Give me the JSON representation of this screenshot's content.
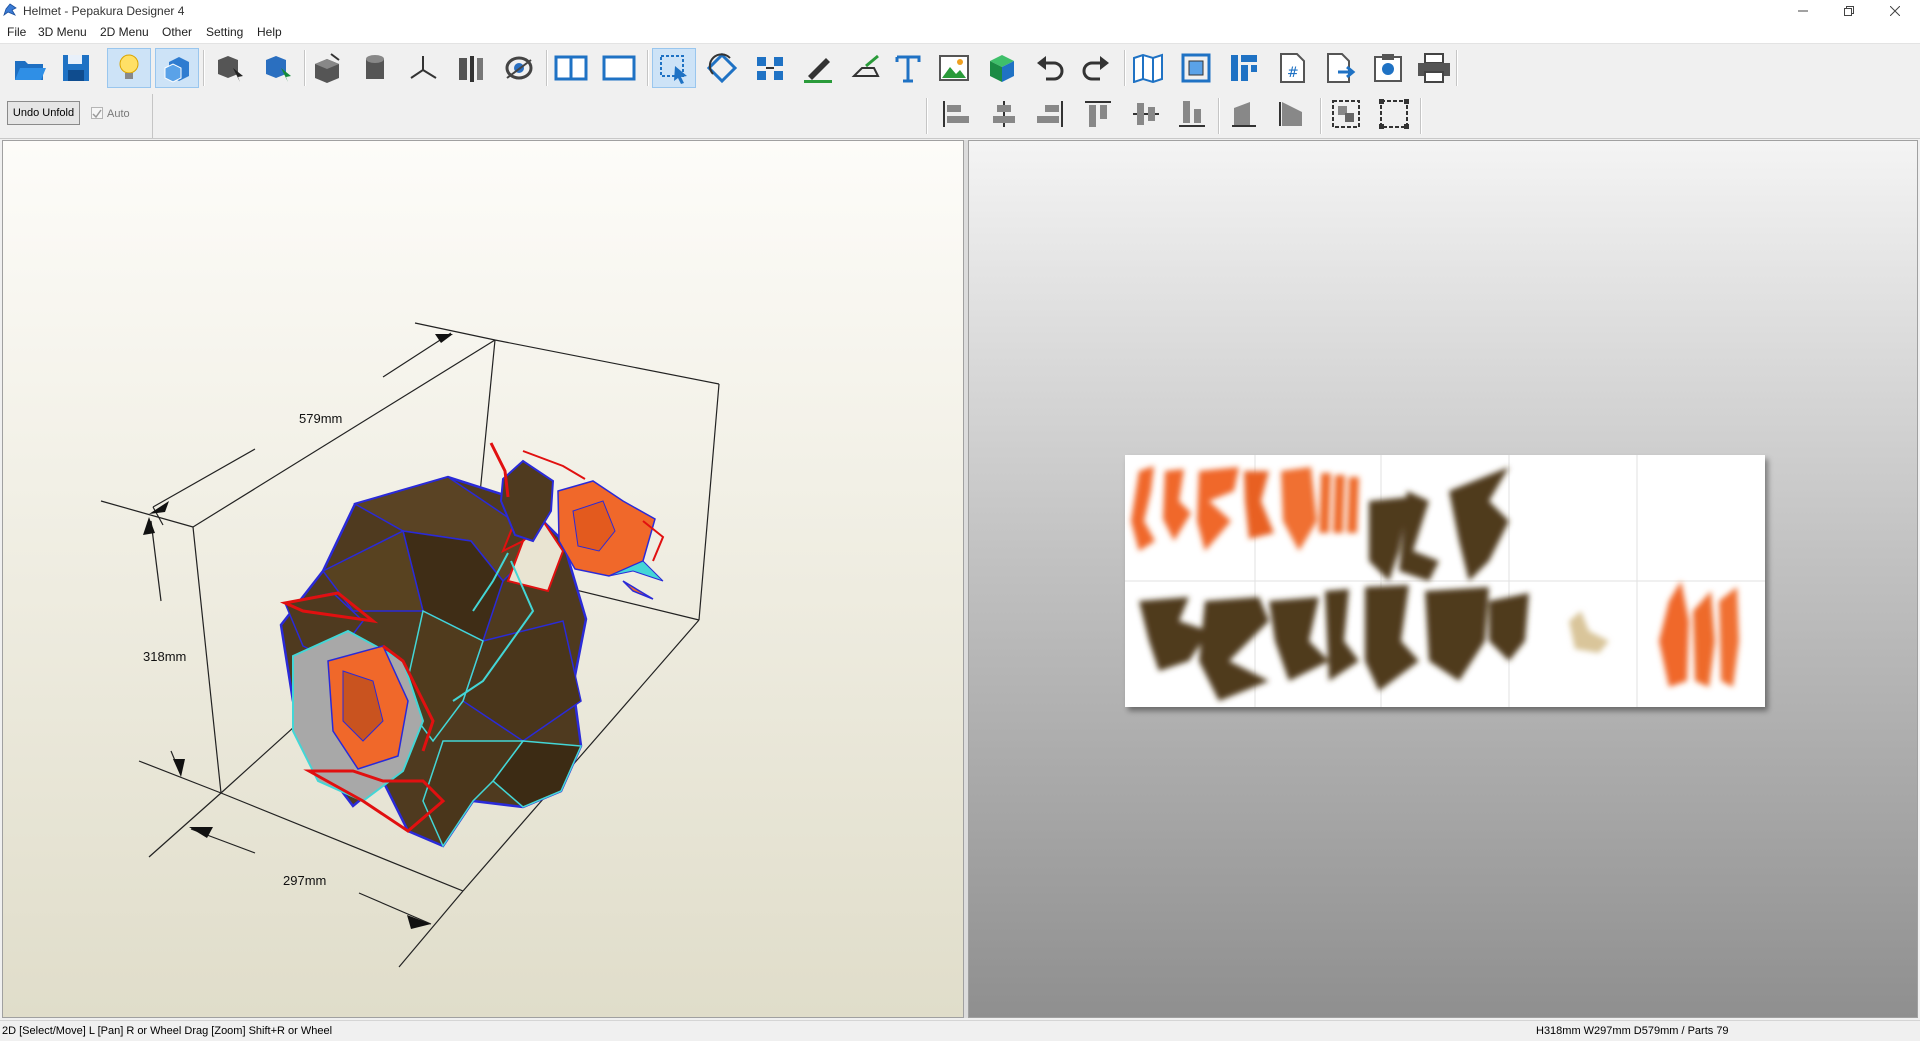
{
  "window": {
    "title": "Helmet - Pepakura Designer 4",
    "controls": [
      "minimize",
      "restore",
      "close"
    ]
  },
  "menu": [
    "File",
    "3D Menu",
    "2D Menu",
    "Other",
    "Setting",
    "Help"
  ],
  "toolbar": {
    "main_icons": [
      "open-icon",
      "save-icon",
      "light-bulb-icon",
      "texture-icon",
      "select-3d-icon",
      "select-face-icon",
      "box-icon",
      "cylinder-icon",
      "axis-icon",
      "columns-icon",
      "eye-icon",
      "split-view-icon",
      "single-view-icon",
      "select-move-icon",
      "rotate-icon",
      "arrange-icon",
      "edit-line-icon",
      "flap-icon",
      "text-icon",
      "image-icon",
      "cube-icon",
      "undo-icon",
      "redo-icon",
      "unfold-icon",
      "fit-view-icon",
      "layout-icon",
      "page-number-icon",
      "export-icon",
      "screenshot-icon",
      "print-icon"
    ],
    "align_icons": [
      "align-left-icon",
      "align-center-icon",
      "align-right-icon",
      "align-top-icon",
      "align-middle-icon",
      "align-bottom-icon",
      "rotate-left-icon",
      "rotate-right-icon",
      "group-icon",
      "ungroup-icon"
    ],
    "undo_unfold_label": "Undo Unfold",
    "auto_label": "Auto",
    "auto_checked": true
  },
  "view3d": {
    "dim_depth": "579mm",
    "dim_height": "318mm",
    "dim_width": "297mm"
  },
  "colors": {
    "model_face": "#4f3a1f",
    "model_edge": "#2a2ad8",
    "cut_edge": "#e11010",
    "orange_part": "#f0682a",
    "cyan_edge": "#43d6d6"
  },
  "status": {
    "left": "2D [Select/Move] L [Pan] R or Wheel Drag [Zoom] Shift+R or Wheel",
    "right": "H318mm W297mm D579mm / Parts 79"
  }
}
